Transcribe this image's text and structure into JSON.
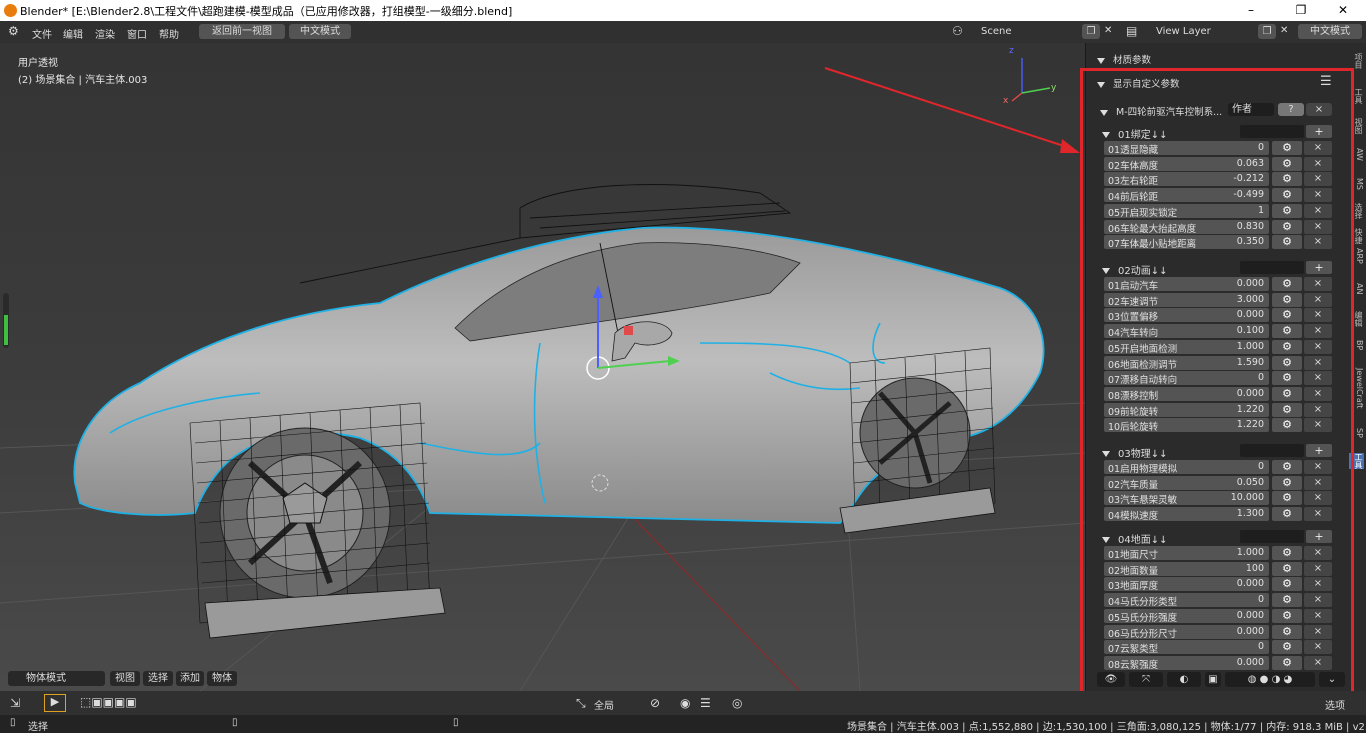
{
  "title": "Blender* [E:\\Blender2.8\\工程文件\\超跑建模-模型成品（已应用修改器，打组模型-一级细分.blend]",
  "menu": [
    "文件",
    "编辑",
    "渲染",
    "窗口",
    "帮助"
  ],
  "menu_buttons": {
    "back": "返回前一视图",
    "chinese_mode": "中文模式"
  },
  "header_right": {
    "scene": "Scene",
    "view_layer": "View Layer",
    "chinese_mode": "中文模式"
  },
  "viewport": {
    "view_name": "用户透视",
    "collection": "(2) 场景集合 | 汽车主体.003"
  },
  "viewport_axis": {
    "x": "x",
    "y": "y",
    "z": "z"
  },
  "viewport_header": {
    "mode": "物体模式",
    "items": [
      "视图",
      "选择",
      "添加",
      "物体"
    ]
  },
  "side_tabs": [
    "项目",
    "工具",
    "视图",
    "AW",
    "MS",
    "选择",
    "快捷",
    "ARP",
    "AN",
    "编辑",
    "BP",
    "JewelCraft",
    "SP",
    "工具"
  ],
  "panel": {
    "material_params": "材质参数",
    "custom_props": "显示自定义参数",
    "rig_name": "M-四轮前驱汽车控制系...",
    "author": "作者",
    "help_icon": "?",
    "close_icon": "×"
  },
  "groups": [
    {
      "name": "01绑定↓↓",
      "props": [
        {
          "label": "01透显隐藏",
          "value": "0"
        },
        {
          "label": "02车体高度",
          "value": "0.063"
        },
        {
          "label": "03左右轮距",
          "value": "-0.212"
        },
        {
          "label": "04前后轮距",
          "value": "-0.499"
        },
        {
          "label": "05开启现实锁定",
          "value": "1"
        },
        {
          "label": "06车轮最大抬起高度",
          "value": "0.830"
        },
        {
          "label": "07车体最小贴地距离",
          "value": "0.350"
        }
      ]
    },
    {
      "name": "02动画↓↓",
      "props": [
        {
          "label": "01启动汽车",
          "value": "0.000"
        },
        {
          "label": "02车速调节",
          "value": "3.000"
        },
        {
          "label": "03位置偏移",
          "value": "0.000"
        },
        {
          "label": "04汽车转向",
          "value": "0.100"
        },
        {
          "label": "05开启地面检测",
          "value": "1.000"
        },
        {
          "label": "06地面检测调节",
          "value": "1.590"
        },
        {
          "label": "07漂移自动转向",
          "value": "0"
        },
        {
          "label": "08漂移控制",
          "value": "0.000"
        },
        {
          "label": "09前轮旋转",
          "value": "1.220"
        },
        {
          "label": "10后轮旋转",
          "value": "1.220"
        }
      ]
    },
    {
      "name": "03物理↓↓",
      "props": [
        {
          "label": "01启用物理模拟",
          "value": "0"
        },
        {
          "label": "02汽车质量",
          "value": "0.050"
        },
        {
          "label": "03汽车悬架灵敏",
          "value": "10.000"
        },
        {
          "label": "04模拟速度",
          "value": "1.300"
        }
      ]
    },
    {
      "name": "04地面↓↓",
      "props": [
        {
          "label": "01地面尺寸",
          "value": "1.000"
        },
        {
          "label": "02地面数量",
          "value": "100"
        },
        {
          "label": "03地面厚度",
          "value": "0.000"
        },
        {
          "label": "04马氏分形类型",
          "value": "0"
        },
        {
          "label": "05马氏分形强度",
          "value": "0.000"
        },
        {
          "label": "06马氏分形尺寸",
          "value": "0.000"
        },
        {
          "label": "07云絮类型",
          "value": "0"
        },
        {
          "label": "08云絮强度",
          "value": "0.000"
        }
      ]
    }
  ],
  "toolbar": {
    "transform_space": "全局",
    "options": "选项"
  },
  "status": {
    "select": "选择",
    "info": "场景集合 | 汽车主体.003 | 点:1,552,880 | 边:1,530,100 | 三角面:3,080,125 | 物体:1/77 | 内存: 918.3 MiB | v2.82.7"
  },
  "colors": {
    "highlight": "#e0262b",
    "selection_outline": "#1fb1e5",
    "panel_bg": "#2b2b2b",
    "field_bg": "#545454"
  }
}
